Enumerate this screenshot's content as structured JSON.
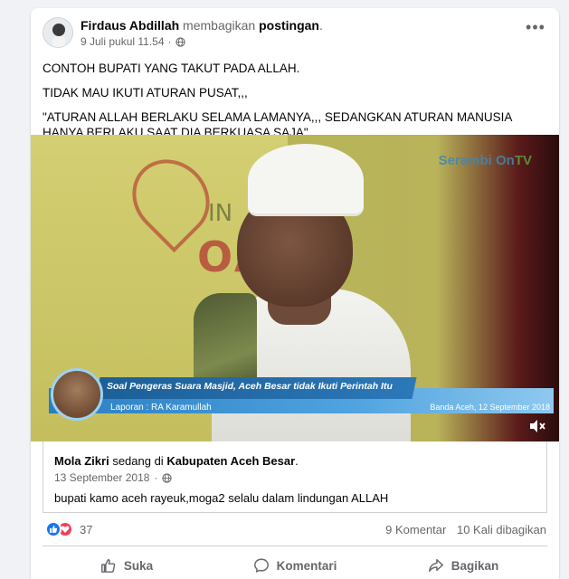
{
  "post": {
    "author": "Firdaus Abdillah",
    "verb": "membagikan",
    "object": "postingan",
    "period": ".",
    "timestamp": "9 Juli pukul 11.54",
    "meta_separator": "·",
    "privacy_icon": "globe-icon",
    "more_icon": "ellipsis-icon",
    "more_label": "•••",
    "text": [
      "CONTOH BUPATI YANG TAKUT PADA ALLAH.",
      "TIDAK MAU IKUTI ATURAN PUSAT,,,",
      "\"ATURAN ALLAH BERLAKU SELAMA LAMANYA,,, SEDANGKAN ATURAN MANUSIA HANYA BERLAKU SAAT DIA BERKUASA SAJA\"."
    ]
  },
  "video": {
    "background_words": [
      "IN",
      "OAQU"
    ],
    "channel_name": "Serambi On",
    "channel_suffix": "TV",
    "headline": "Soal Pengeras Suara Masjid, Aceh Besar tidak Ikuti Perintah Itu",
    "reporter": "Laporan : RA Karamullah",
    "location_date": "Banda Aceh, 12 September 2018",
    "mute_icon": "speaker-muted-icon"
  },
  "shared": {
    "author": "Mola Zikri",
    "verb": "sedang di",
    "place": "Kabupaten Aceh Besar",
    "period": ".",
    "timestamp": "13 September 2018",
    "meta_separator": "·",
    "privacy_icon": "globe-icon",
    "text": "bupati kamo aceh rayeuk,moga2 selalu dalam lindungan ALLAH"
  },
  "stats": {
    "reaction_icons": [
      "like-icon",
      "love-icon"
    ],
    "reaction_count": "37",
    "comments": "9 Komentar",
    "shares": "10 Kali dibagikan"
  },
  "actions": {
    "like": "Suka",
    "comment": "Komentari",
    "share": "Bagikan"
  },
  "colors": {
    "like_blue": "#1877f2",
    "love_red": "#f33e58",
    "secondary_text": "#65676b",
    "lower_third_blue": "#2a7ec3"
  }
}
